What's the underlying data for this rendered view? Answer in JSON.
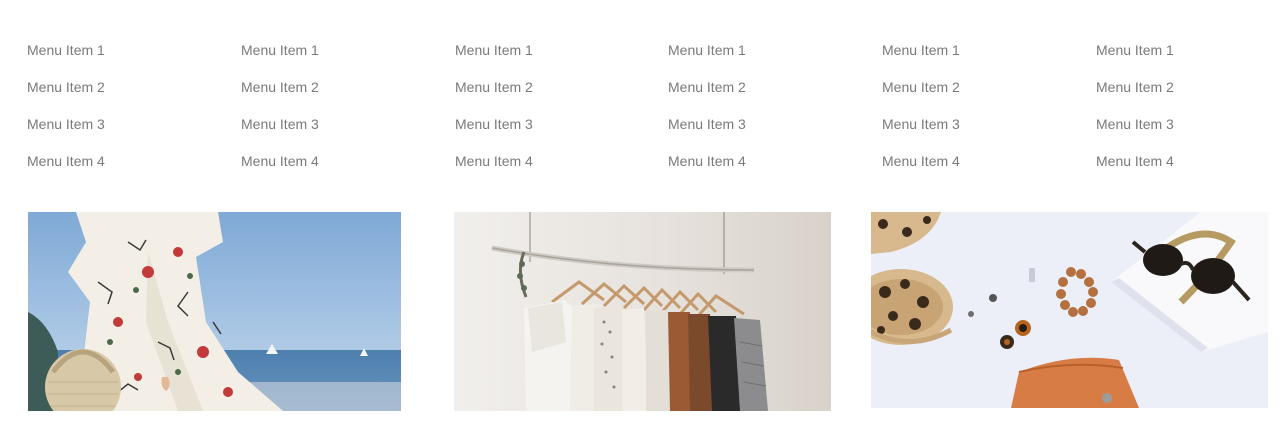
{
  "menu_columns": [
    {
      "items": [
        "Menu Item 1",
        "Menu Item 2",
        "Menu Item 3",
        "Menu Item 4"
      ]
    },
    {
      "items": [
        "Menu Item 1",
        "Menu Item 2",
        "Menu Item 3",
        "Menu Item 4"
      ]
    },
    {
      "items": [
        "Menu Item 1",
        "Menu Item 2",
        "Menu Item 3",
        "Menu Item 4"
      ]
    },
    {
      "items": [
        "Menu Item 1",
        "Menu Item 2",
        "Menu Item 3",
        "Menu Item 4"
      ]
    },
    {
      "items": [
        "Menu Item 1",
        "Menu Item 2",
        "Menu Item 3",
        "Menu Item 4"
      ]
    },
    {
      "items": [
        "Menu Item 1",
        "Menu Item 2",
        "Menu Item 3",
        "Menu Item 4"
      ]
    }
  ],
  "colors": {
    "menu_text": "#7a7a7a",
    "background": "#ffffff"
  },
  "images": [
    {
      "name": "floral-dress-beach-photo"
    },
    {
      "name": "clothing-rack-photo"
    },
    {
      "name": "accessories-flatlay-photo"
    }
  ]
}
